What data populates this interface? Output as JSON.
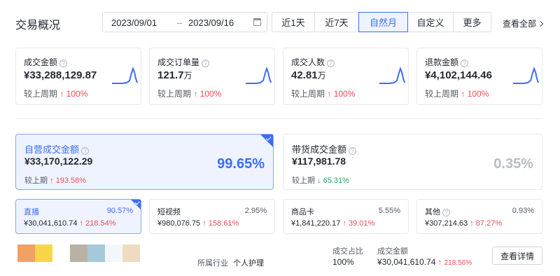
{
  "header": {
    "title": "交易概况",
    "date_start": "2023/09/01",
    "date_sep": "–",
    "date_end": "2023/09/16",
    "range_options": [
      "近1天",
      "近7天",
      "自然月",
      "自定义",
      "更多"
    ],
    "active_range": "自然月",
    "view_all": "查看全部"
  },
  "metrics": [
    {
      "label": "成交金额",
      "value": "¥33,288,129.87",
      "unit": "",
      "compare_label": "较上周期",
      "change": "100%",
      "direction": "up"
    },
    {
      "label": "成交订单量",
      "value": "121.7",
      "unit": "万",
      "compare_label": "较上周期",
      "change": "100%",
      "direction": "up"
    },
    {
      "label": "成交人数",
      "value": "42.81",
      "unit": "万",
      "compare_label": "较上周期",
      "change": "100%",
      "direction": "up"
    },
    {
      "label": "退款金额",
      "value": "¥4,102,144.46",
      "unit": "",
      "compare_label": "较上周期",
      "change": "100%",
      "direction": "up"
    }
  ],
  "channels": [
    {
      "label": "自营成交金额",
      "value": "¥33,170,122.29",
      "share": "99.65%",
      "compare_label": "较上期",
      "change": "193.58%",
      "direction": "up",
      "selected": true
    },
    {
      "label": "带货成交金额",
      "value": "¥117,981.78",
      "share": "0.35%",
      "compare_label": "较上期",
      "change": "65.31%",
      "direction": "down",
      "selected": false
    }
  ],
  "sub_channels": [
    {
      "label": "直播",
      "share": "90.57%",
      "value": "¥30,041,610.74",
      "change": "218.54%",
      "selected": true,
      "help": false
    },
    {
      "label": "短视频",
      "share": "2.95%",
      "value": "¥980,076.75",
      "change": "158.61%",
      "selected": false,
      "help": false
    },
    {
      "label": "商品卡",
      "share": "5.55%",
      "value": "¥1,841,220.17",
      "change": "39.01%",
      "selected": false,
      "help": false
    },
    {
      "label": "其他",
      "share": "0.93%",
      "value": "¥307,214.63",
      "change": "87.27%",
      "selected": false,
      "help": true
    }
  ],
  "footer": {
    "industry_label": "所属行业",
    "industry_value": "个人护理",
    "share_label": "成交占比",
    "share_value": "100%",
    "amount_label": "成交金额",
    "amount_value": "¥30,041,610.74",
    "amount_change": "218.56%",
    "detail_button": "查看详情",
    "swatch_colors": [
      "#f2a164",
      "#f6d646",
      "#ffffff",
      "#b9b2a4",
      "#a7c7da",
      "#f4f7fa",
      "#efdcc0"
    ]
  },
  "colors": {
    "accent": "#3b6ef6",
    "up": "#f04b55",
    "down": "#22a867",
    "share_muted": "#b8bcc4"
  }
}
